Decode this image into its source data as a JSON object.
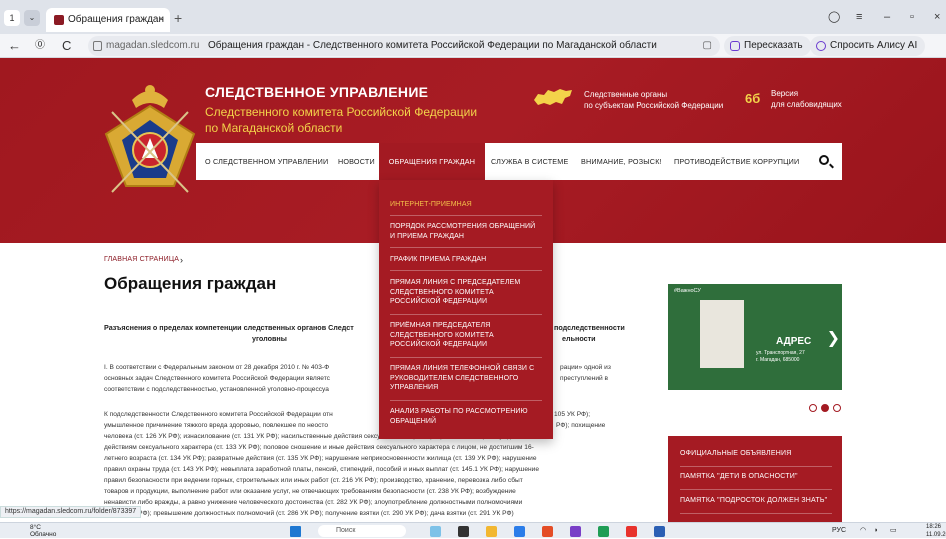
{
  "browser": {
    "tab_number": "1",
    "tab_dropdown": "⌄",
    "tab_title": "Обращения граждан",
    "tab_close": "×",
    "new_tab": "+",
    "url_domain": "magadan.sledcom.ru",
    "page_title": "Обращения граждан - Следственного комитета Российской Федерации по Магаданской области",
    "retell_label": "Пересказать",
    "alice_label": "Спросить Алису AI",
    "back": "←",
    "reload": "C",
    "bookmark": "▢"
  },
  "header": {
    "org_title": "СЛЕДСТВЕННОЕ УПРАВЛЕНИЕ",
    "org_subtitle_line1": "Следственного комитета Российской Федерации",
    "org_subtitle_line2": "по Магаданской области",
    "regional_line1": "Следственные органы",
    "regional_line2": "по субъектам Российской Федерации",
    "visually_impaired_line1": "Версия",
    "visually_impaired_line2": "для слабовидящих",
    "glasses": "6б"
  },
  "menu": {
    "items": [
      "О СЛЕДСТВЕННОМ УПРАВЛЕНИИ",
      "НОВОСТИ",
      "ОБРАЩЕНИЯ ГРАЖДАН",
      "СЛУЖБА В СИСТЕМЕ",
      "ВНИМАНИЕ, РОЗЫСК!",
      "ПРОТИВОДЕЙСТВИЕ КОРРУПЦИИ"
    ]
  },
  "dropdown": {
    "items": [
      "ИНТЕРНЕТ-ПРИЕМНАЯ",
      "ПОРЯДОК РАССМОТРЕНИЯ ОБРАЩЕНИЙ И ПРИЕМА ГРАЖДАН",
      "ГРАФИК ПРИЕМА ГРАЖДАН",
      "ПРЯМАЯ ЛИНИЯ С ПРЕДСЕДАТЕЛЕМ СЛЕДСТВЕННОГО КОМИТЕТА РОССИЙСКОЙ ФЕДЕРАЦИИ",
      "ПРИЁМНАЯ ПРЕДСЕДАТЕЛЯ СЛЕДСТВЕННОГО КОМИТЕТА РОССИЙСКОЙ ФЕДЕРАЦИИ",
      "ПРЯМАЯ ЛИНИЯ ТЕЛЕФОННОЙ СВЯЗИ С РУКОВОДИТЕЛЕМ СЛЕДСТВЕННОГО УПРАВЛЕНИЯ",
      "АНАЛИЗ РАБОТЫ ПО РАССМОТРЕНИЮ ОБРАЩЕНИЙ"
    ]
  },
  "content": {
    "breadcrumb": "ГЛАВНАЯ СТРАНИЦА",
    "breadcrumb_arrow": "›",
    "title": "Обращения граждан",
    "subtitle_left_1": "Разъяснения о пределах компетенции следственных органов Следст",
    "subtitle_left_2": "уголовны",
    "subtitle_right_1": "подследственности",
    "subtitle_right_2": "ельности",
    "para1_a": "I. В соответствии с Федеральным законом от 28 декабря 2010 г. № 403-Ф",
    "para1_a_right": "рации» одной из",
    "para1_b": "основных задач Следственного комитета Российской Федерации являетс",
    "para1_b_right": "преступлений в",
    "para1_c": "соответствии с подследственностью, установленной уголовно-процессуа",
    "para2_1": "К подследственности Следственного комитета Российской Федерации отн",
    "para2_1_right": "105 УК РФ);",
    "para2_2": "умышленное причинение тяжкого вреда здоровью, повлекшее по неосто",
    "para2_2_right": "РФ); похищение",
    "para2_3": "человека (ст. 126 УК РФ); изнасилование (ст. 131 УК РФ); насильственные действия сексуального характера (ст. 132 УК РФ); понуждение к",
    "para2_4": "действиям сексуального характера (ст. 133 УК РФ); половое сношение и иные действия сексуального характера с лицом, не достигшим 16-",
    "para2_5": "летнего возраста (ст. 134 УК РФ); развратные действия (ст. 135 УК РФ); нарушение неприкосновенности жилища (ст. 139 УК РФ); нарушение",
    "para2_6": "правил охраны труда (ст. 143 УК РФ); невыплата заработной платы, пенсий, стипендий, пособий и иных выплат (ст. 145.1 УК РФ); нарушение",
    "para2_7": "правил безопасности при ведении горных, строительных или иных работ (ст. 216 УК РФ); производство, хранение, перевозка либо сбыт",
    "para2_8": "товаров и продукции, выполнение работ или оказание услуг, не отвечающих требованиям безопасности (ст. 238 УК РФ); возбуждение",
    "para2_9": "ненависти либо вражды, а равно унижение человеческого достоинства (ст. 282 УК РФ); злоупотребление должностными полномочиями",
    "para2_10": "(ст. 285 УК РФ); превышение должностных полномочий (ст. 286 УК РФ); получение взятки (ст. 290 УК РФ); дача взятки (ст. 291 УК РФ)"
  },
  "promo": {
    "hashtag": "#ВажноСУ",
    "label": "АДРЕС",
    "address_line1": "ул. Транспортная, 27",
    "address_line2": "г. Магадан, 685000",
    "arrow": "❯"
  },
  "sidebar": {
    "items": [
      "ОФИЦИАЛЬНЫЕ ОБЪЯВЛЕНИЯ",
      "ПАМЯТКА \"ДЕТИ В ОПАСНОСТИ\"",
      "ПАМЯТКА \"ПОДРОСТОК ДОЛЖЕН ЗНАТЬ\""
    ]
  },
  "status": {
    "url": "https://magadan.sledcom.ru/folder/873397"
  },
  "taskbar": {
    "temp": "8°C",
    "weather": "Облачно",
    "search": "Поиск",
    "lang": "РУС",
    "time": "18:26",
    "date": "11.09.2025"
  }
}
